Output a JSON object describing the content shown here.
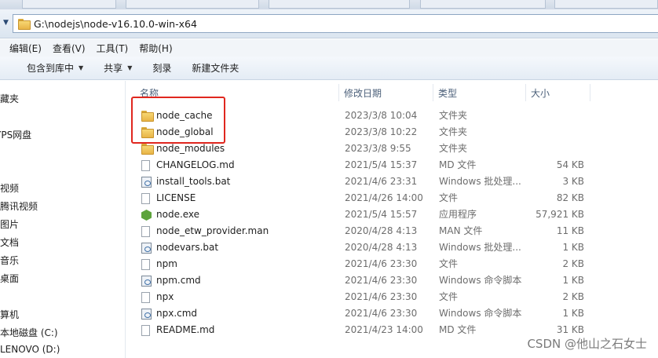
{
  "address": {
    "path": "G:\\nodejs\\node-v16.10.0-win-x64"
  },
  "menu": [
    "编辑(E)",
    "查看(V)",
    "工具(T)",
    "帮助(H)"
  ],
  "commands": [
    {
      "label": "包含到库中",
      "has_dropdown": true
    },
    {
      "label": "共享",
      "has_dropdown": true
    },
    {
      "label": "刻录",
      "has_dropdown": false
    },
    {
      "label": "新建文件夹",
      "has_dropdown": false
    }
  ],
  "nav": [
    "藏夹",
    "YPS网盘",
    "视频",
    "腾讯视频",
    "图片",
    "文档",
    "音乐",
    "桌面",
    "算机",
    "本地磁盘 (C:)",
    "LENOVO (D:)"
  ],
  "columns": {
    "name": "名称",
    "date": "修改日期",
    "type": "类型",
    "size": "大小"
  },
  "files": [
    {
      "name": "node_cache",
      "date": "2023/3/8 10:04",
      "type": "文件夹",
      "size": "",
      "icon": "folder-icon"
    },
    {
      "name": "node_global",
      "date": "2023/3/8 10:22",
      "type": "文件夹",
      "size": "",
      "icon": "folder-icon"
    },
    {
      "name": "node_modules",
      "date": "2023/3/8 9:55",
      "type": "文件夹",
      "size": "",
      "icon": "folder-icon"
    },
    {
      "name": "CHANGELOG.md",
      "date": "2021/5/4 15:37",
      "type": "MD 文件",
      "size": "54 KB",
      "icon": "document-icon"
    },
    {
      "name": "install_tools.bat",
      "date": "2021/4/6 23:31",
      "type": "Windows 批处理...",
      "size": "3 KB",
      "icon": "batch-file-icon"
    },
    {
      "name": "LICENSE",
      "date": "2021/4/26 14:00",
      "type": "文件",
      "size": "82 KB",
      "icon": "document-icon"
    },
    {
      "name": "node.exe",
      "date": "2021/5/4 15:57",
      "type": "应用程序",
      "size": "57,921 KB",
      "icon": "node-exe-icon"
    },
    {
      "name": "node_etw_provider.man",
      "date": "2020/4/28 4:13",
      "type": "MAN 文件",
      "size": "11 KB",
      "icon": "document-icon"
    },
    {
      "name": "nodevars.bat",
      "date": "2020/4/28 4:13",
      "type": "Windows 批处理...",
      "size": "1 KB",
      "icon": "batch-file-icon"
    },
    {
      "name": "npm",
      "date": "2021/4/6 23:30",
      "type": "文件",
      "size": "2 KB",
      "icon": "document-icon"
    },
    {
      "name": "npm.cmd",
      "date": "2021/4/6 23:30",
      "type": "Windows 命令脚本",
      "size": "1 KB",
      "icon": "batch-file-icon"
    },
    {
      "name": "npx",
      "date": "2021/4/6 23:30",
      "type": "文件",
      "size": "2 KB",
      "icon": "document-icon"
    },
    {
      "name": "npx.cmd",
      "date": "2021/4/6 23:30",
      "type": "Windows 命令脚本",
      "size": "1 KB",
      "icon": "batch-file-icon"
    },
    {
      "name": "README.md",
      "date": "2021/4/23 14:00",
      "type": "MD 文件",
      "size": "31 KB",
      "icon": "document-icon"
    }
  ],
  "watermark": "CSDN @他山之石女士",
  "colors": {
    "highlight": "#e0271f",
    "folder": "#f0c65a"
  }
}
